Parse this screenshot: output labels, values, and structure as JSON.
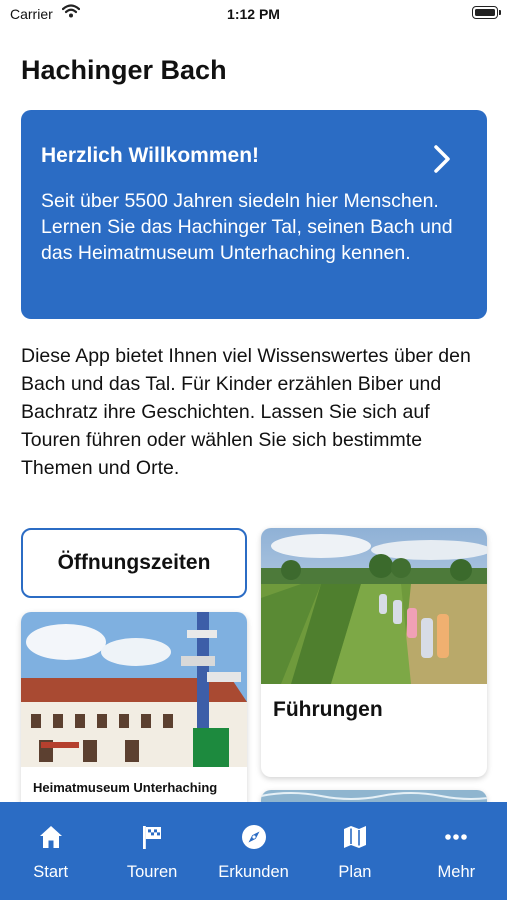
{
  "status_bar": {
    "carrier": "Carrier",
    "time": "1:12 PM"
  },
  "page": {
    "title": "Hachinger Bach"
  },
  "welcome_card": {
    "title": "Herzlich Willkommen!",
    "text": "Seit über 5500 Jahren siedeln hier Menschen. Lernen Sie das Hachinger Tal, seinen Bach und das Heimatmuseum Unterhaching kennen."
  },
  "intro_text": "Diese App bietet Ihnen viel Wissenswertes über den Bach und das Tal. Für Kinder erzählen Biber und Bachratz ihre Geschichten. Lassen Sie sich auf Touren führen oder wählen Sie sich bestimmte Themen und Orte.",
  "tiles": {
    "hours": "Öffnungszeiten",
    "tours": "Führungen",
    "museum": "Heimatmuseum Unterhaching"
  },
  "tab_bar": {
    "items": [
      {
        "label": "Start",
        "icon": "home-icon"
      },
      {
        "label": "Touren",
        "icon": "flag-icon"
      },
      {
        "label": "Erkunden",
        "icon": "compass-icon"
      },
      {
        "label": "Plan",
        "icon": "map-icon"
      },
      {
        "label": "Mehr",
        "icon": "more-icon"
      }
    ]
  },
  "colors": {
    "accent": "#2b6cc4",
    "text": "#111111",
    "background": "#ffffff"
  }
}
